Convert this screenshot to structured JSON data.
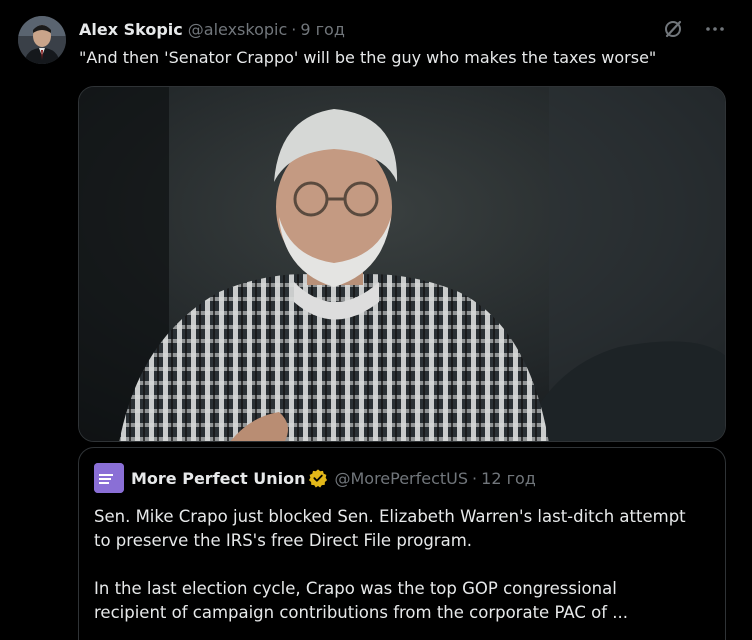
{
  "author": {
    "display_name": "Alex Skopic",
    "handle": "@alexskopic",
    "separator": "·",
    "time": "9 год"
  },
  "tweet": {
    "text": "\"And then 'Senator Crappo' will be the guy who makes the taxes worse\""
  },
  "icons": {
    "grok": "grok-slash-circle-icon",
    "more": "more-horizontal-icon",
    "verified": "verified-gold-badge-icon"
  },
  "quote": {
    "avatar_text": "MORE PERFECT UNION",
    "display_name": "More Perfect Union",
    "handle": "@MorePerfectUS",
    "separator": "·",
    "time": "12 год",
    "paragraph1_line1": "Sen. Mike Crapo just blocked Sen. Elizabeth Warren's last-ditch attempt",
    "paragraph1_line2": "to preserve the IRS's free Direct File program.",
    "paragraph2_line1": "In the last election cycle, Crapo was the top GOP congressional",
    "paragraph2_line2": "recipient of campaign contributions from the corporate PAC of ..."
  },
  "colors": {
    "background": "#000000",
    "primary_text": "#e7e9ea",
    "secondary_text": "#71767b",
    "border": "#2f3336",
    "verified_gold": "#e2b719",
    "quote_avatar": "#8a6fd6"
  }
}
